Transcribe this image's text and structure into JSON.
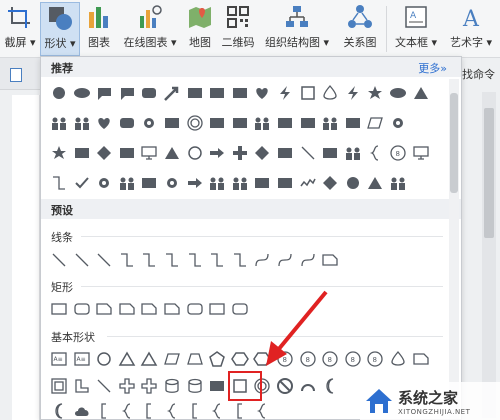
{
  "ribbon": {
    "items": [
      {
        "label": "截屏",
        "icon": "screenshot-icon",
        "dropdown": true
      },
      {
        "label": "形状",
        "icon": "shapes-icon",
        "dropdown": true,
        "active": true
      },
      {
        "label": "图表",
        "icon": "bar-chart-icon",
        "dropdown": false
      },
      {
        "label": "在线图表",
        "icon": "online-chart-icon",
        "dropdown": true
      },
      {
        "label": "地图",
        "icon": "map-icon",
        "dropdown": false
      },
      {
        "label": "二维码",
        "icon": "qrcode-icon",
        "dropdown": false
      },
      {
        "label": "组织结构图",
        "icon": "org-chart-icon",
        "dropdown": true
      },
      {
        "label": "关系图",
        "icon": "relation-chart-icon",
        "dropdown": false
      },
      {
        "label": "文本框",
        "icon": "textbox-icon",
        "dropdown": true
      },
      {
        "label": "艺术字",
        "icon": "wordart-icon",
        "dropdown": true
      }
    ]
  },
  "right_panel": {
    "find_label": "找命令"
  },
  "panel": {
    "recommended_title": "推荐",
    "more_label": "更多»",
    "preset_title": "预设",
    "categories": {
      "lines": "线条",
      "rectangles": "矩形",
      "basic": "基本形状"
    }
  },
  "colors": {
    "accent": "#2d6fd0",
    "icon_gray": "#555b63",
    "highlight": "#e02222"
  },
  "watermark": {
    "title": "系统之家",
    "url": "XITONGZHIJIA.NET"
  }
}
